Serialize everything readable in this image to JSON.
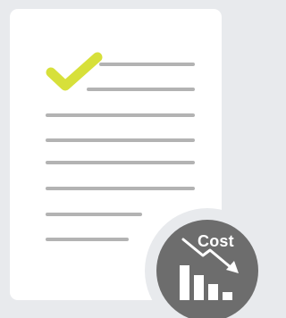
{
  "document": {
    "check_icon": "checkmark-icon",
    "check_color": "#d7e03a",
    "line_color": "#b3b3b3"
  },
  "badge": {
    "label": "Cost",
    "icon": "cost-down-chart-icon",
    "background": "#6d6d6d"
  }
}
